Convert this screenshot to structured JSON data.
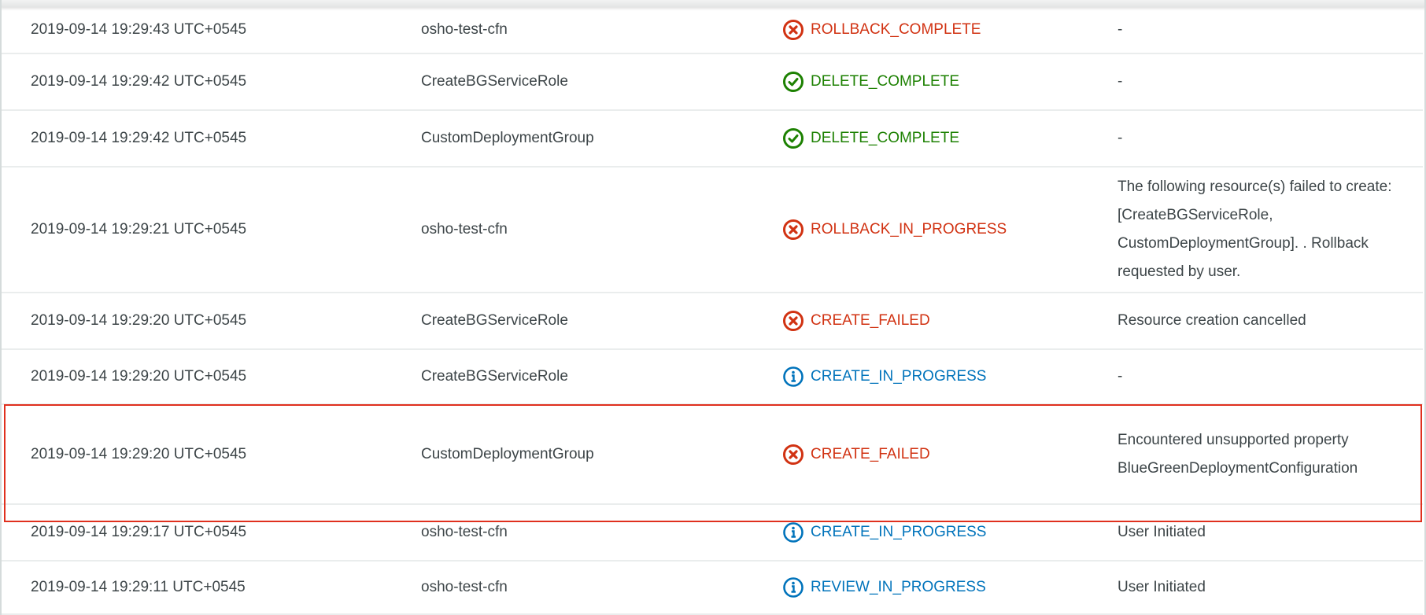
{
  "colors": {
    "failed": "#d13212",
    "complete": "#1d8102",
    "info": "#0073bb",
    "highlight": "#e0301e"
  },
  "events": [
    {
      "timestamp": "2019-09-14 19:29:43 UTC+0545",
      "logical_id": "osho-test-cfn",
      "status": "ROLLBACK_COMPLETE",
      "status_type": "failed",
      "icon": "x-circle-icon",
      "reason": "-"
    },
    {
      "timestamp": "2019-09-14 19:29:42 UTC+0545",
      "logical_id": "CreateBGServiceRole",
      "status": "DELETE_COMPLETE",
      "status_type": "complete",
      "icon": "check-circle-icon",
      "reason": "-"
    },
    {
      "timestamp": "2019-09-14 19:29:42 UTC+0545",
      "logical_id": "CustomDeploymentGroup",
      "status": "DELETE_COMPLETE",
      "status_type": "complete",
      "icon": "check-circle-icon",
      "reason": "-"
    },
    {
      "timestamp": "2019-09-14 19:29:21 UTC+0545",
      "logical_id": "osho-test-cfn",
      "status": "ROLLBACK_IN_PROGRESS",
      "status_type": "failed",
      "icon": "x-circle-icon",
      "reason": "The following resource(s) failed to create: [CreateBGServiceRole, CustomDeploymentGroup]. . Rollback requested by user."
    },
    {
      "timestamp": "2019-09-14 19:29:20 UTC+0545",
      "logical_id": "CreateBGServiceRole",
      "status": "CREATE_FAILED",
      "status_type": "failed",
      "icon": "x-circle-icon",
      "reason": "Resource creation cancelled"
    },
    {
      "timestamp": "2019-09-14 19:29:20 UTC+0545",
      "logical_id": "CreateBGServiceRole",
      "status": "CREATE_IN_PROGRESS",
      "status_type": "info",
      "icon": "info-circle-icon",
      "reason": "-"
    },
    {
      "timestamp": "2019-09-14 19:29:20 UTC+0545",
      "logical_id": "CustomDeploymentGroup",
      "status": "CREATE_FAILED",
      "status_type": "failed",
      "icon": "x-circle-icon",
      "reason": "Encountered unsupported property BlueGreenDeploymentConfiguration",
      "highlighted": true
    },
    {
      "timestamp": "2019-09-14 19:29:17 UTC+0545",
      "logical_id": "osho-test-cfn",
      "status": "CREATE_IN_PROGRESS",
      "status_type": "info",
      "icon": "info-circle-icon",
      "reason": "User Initiated"
    },
    {
      "timestamp": "2019-09-14 19:29:11 UTC+0545",
      "logical_id": "osho-test-cfn",
      "status": "REVIEW_IN_PROGRESS",
      "status_type": "info",
      "icon": "info-circle-icon",
      "reason": "User Initiated"
    }
  ]
}
